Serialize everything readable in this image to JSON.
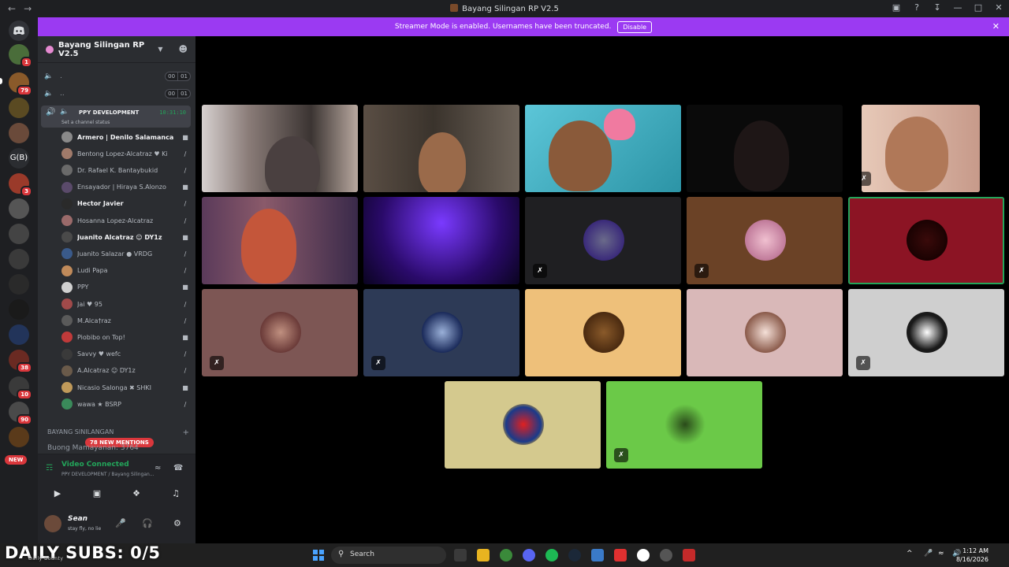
{
  "window": {
    "title": "Bayang Silingan RP V2.5"
  },
  "banner": {
    "message": "Streamer Mode is enabled. Usernames have been truncated.",
    "disable_label": "Disable"
  },
  "guild_badges": [
    "1",
    "79",
    "3",
    "38",
    "10",
    "90"
  ],
  "guild_text_label": "G(B)",
  "guild_new_label": "NEW",
  "server": {
    "name": "Bayang Silingan RP V2.5"
  },
  "voice_channels": [
    {
      "label": ".",
      "count_a": "00",
      "count_b": "01"
    },
    {
      "label": "..",
      "count_a": "00",
      "count_b": "01"
    }
  ],
  "active_channel": {
    "name": "PPY DEVELOPMENT",
    "timer": "10:31:10",
    "status": "Set a channel status"
  },
  "members": [
    {
      "name": "Armero | Denilo Salamanca",
      "bold": true
    },
    {
      "name": "Bentong Lopez-Alcatraz ♥ Ki",
      "bold": false
    },
    {
      "name": "Dr. Rafael K. Bantaybukid",
      "bold": false
    },
    {
      "name": "Ensayador | Hiraya S.Alonzo",
      "bold": false
    },
    {
      "name": "Hector Javier",
      "bold": true
    },
    {
      "name": "Hosanna Lopez-Alcatraz",
      "bold": false
    },
    {
      "name": "Juanito Alcatraz ☺ DY1z",
      "bold": true
    },
    {
      "name": "Juanito Salazar ● VRDG",
      "bold": false
    },
    {
      "name": "Ludi Papa",
      "bold": false
    },
    {
      "name": "PPY",
      "bold": false
    },
    {
      "name": "Jai ♥ 95",
      "bold": false
    },
    {
      "name": "M.Alca†raz",
      "bold": false
    },
    {
      "name": "Piobibo on Top!",
      "bold": false
    },
    {
      "name": "Savvy ♥ wefc",
      "bold": false
    },
    {
      "name": "A.Alcatraz ☺ DY1z",
      "bold": false
    },
    {
      "name": "Nicasio Salonga ✖ SHKI",
      "bold": false
    },
    {
      "name": "wawa ★ BSRP",
      "bold": false
    }
  ],
  "category": {
    "name": "BAYANG SINILANGAN"
  },
  "mentions_label": "78 NEW MENTIONS",
  "buong_channel": "Buong Mamayanan: 3764",
  "rtc": {
    "status": "Video Connected",
    "sub": "PPY DEVELOPMENT / Bayang Silingan..."
  },
  "user": {
    "name": "Sean",
    "status": "stay fly, no lie"
  },
  "overlay": {
    "daily_subs": "DAILY SUBS: 0/5",
    "small": "Daily Bounty"
  },
  "taskbar": {
    "search_placeholder": "Search",
    "time": "1:12 AM",
    "date": "8/16/2026"
  },
  "colors": {
    "accent": "#9b3af2",
    "speaking": "#23a55a",
    "badge": "#da373c"
  }
}
